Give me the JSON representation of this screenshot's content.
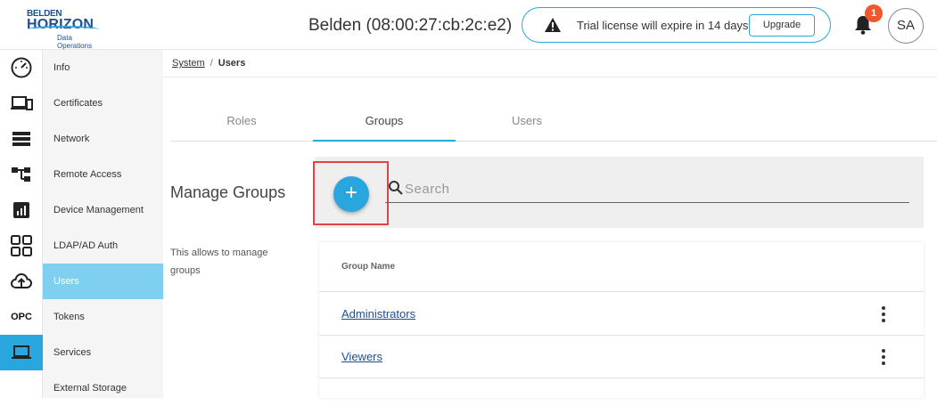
{
  "header": {
    "logo": {
      "line1": "BELDEN",
      "line2": "HORIZON",
      "line3": "Data Operations"
    },
    "device_title": "Belden (08:00:27:cb:2c:e2)",
    "license_message": "Trial license will expire in 14 days",
    "upgrade_label": "Upgrade",
    "notification_count": "1",
    "user_initials": "SA"
  },
  "rail": {
    "items": [
      {
        "icon": "dashboard-gauge-icon"
      },
      {
        "icon": "devices-icon"
      },
      {
        "icon": "list-icon"
      },
      {
        "icon": "hierarchy-icon"
      },
      {
        "icon": "analytics-icon"
      },
      {
        "icon": "apps-grid-icon"
      },
      {
        "icon": "cloud-upload-icon"
      },
      {
        "icon": "opc-icon",
        "label": "OPC"
      },
      {
        "icon": "laptop-icon",
        "active": true
      }
    ]
  },
  "submenu": {
    "items": [
      {
        "label": "Info"
      },
      {
        "label": "Certificates"
      },
      {
        "label": "Network"
      },
      {
        "label": "Remote Access"
      },
      {
        "label": "Device Management"
      },
      {
        "label": "LDAP/AD Auth"
      },
      {
        "label": "Users",
        "active": true
      },
      {
        "label": "Tokens"
      },
      {
        "label": "Services"
      },
      {
        "label": "External Storage"
      }
    ]
  },
  "breadcrumb": {
    "parent": "System",
    "separator": "/",
    "current": "Users"
  },
  "tabs": [
    {
      "label": "Roles"
    },
    {
      "label": "Groups",
      "active": true
    },
    {
      "label": "Users"
    }
  ],
  "manage": {
    "title": "Manage Groups",
    "description": "This allows to manage groups"
  },
  "search": {
    "placeholder": "Search",
    "value": ""
  },
  "table": {
    "column_header": "Group Name",
    "rows": [
      {
        "name": "Administrators"
      },
      {
        "name": "Viewers"
      }
    ]
  },
  "colors": {
    "accent": "#2aa6de",
    "brand_navy": "#1d4f91",
    "badge": "#f2582a",
    "highlight": "#e0444a",
    "submenu_active": "#7fd0f0"
  }
}
